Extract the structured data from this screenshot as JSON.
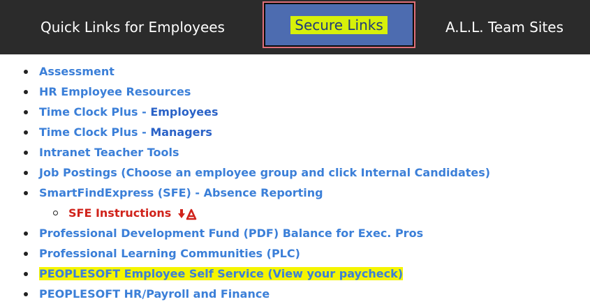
{
  "tabs": {
    "quick": "Quick Links for Employees",
    "secure": "Secure Links",
    "teams": "A.L.L. Team Sites"
  },
  "links": {
    "assessment": "Assessment",
    "hr_resources": "HR Employee Resources",
    "tcp_employees_prefix": "Time Clock Plus - ",
    "tcp_employees_strong": "Employees",
    "tcp_managers_prefix": "Time Clock Plus - ",
    "tcp_managers_strong": "Managers",
    "teacher_tools": "Intranet Teacher Tools",
    "job_postings": "Job Postings (Choose an employee group and click Internal Candidates)",
    "smartfind": "SmartFindExpress (SFE) - Absence Reporting",
    "sfe_instructions": "SFE Instructions",
    "pdf_balance": "Professional Development Fund (PDF) Balance for Exec. Pros",
    "plc": "Professional Learning Communities (PLC)",
    "peoplesoft_self_service": "PEOPLESOFT Employee Self Service (View your paycheck)",
    "peoplesoft_hr": "PEOPLESOFT HR/Payroll and Finance"
  },
  "colors": {
    "tab_bar": "#2b2b2b",
    "active_tab": "#4d6cb0",
    "link": "#3b7fd8",
    "sub_link": "#d0231b",
    "highlight": "#f5f500"
  },
  "icons": {
    "pdf": "adobe-pdf-download-icon"
  }
}
